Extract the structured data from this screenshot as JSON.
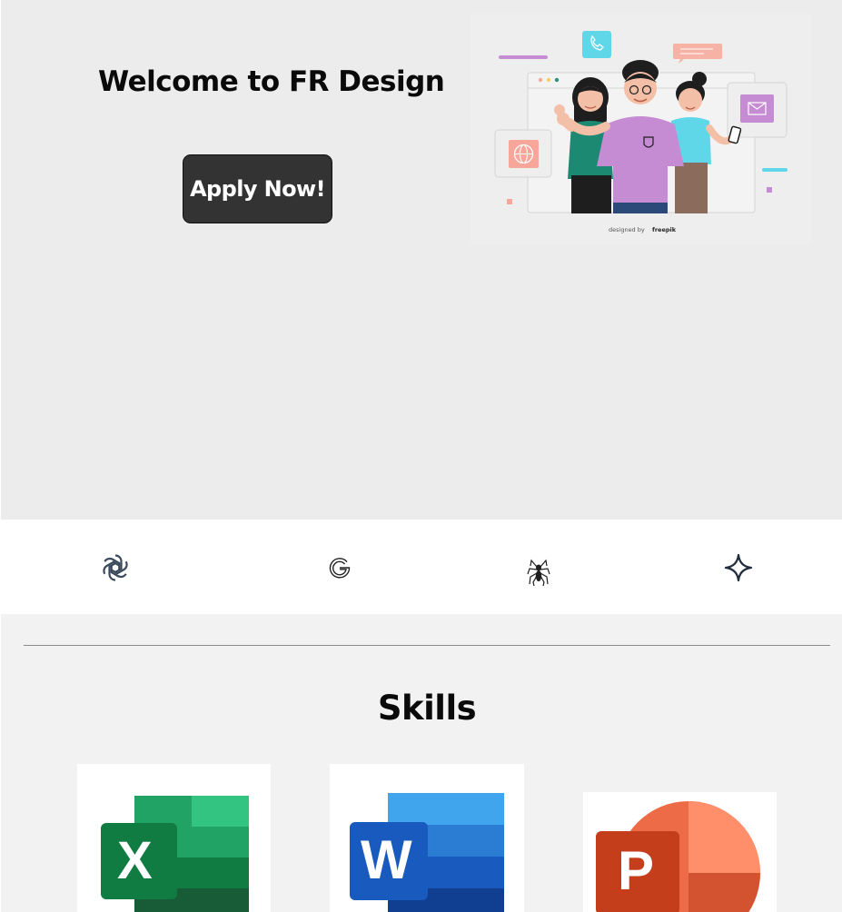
{
  "hero": {
    "title": "Welcome to FR Design",
    "apply_label": "Apply Now!",
    "illustration": {
      "credit_prefix": "designed by",
      "credit_brand": "freepik"
    }
  },
  "logos": [
    {
      "icon": "openai-icon"
    },
    {
      "icon": "google-g-icon"
    },
    {
      "icon": "spider-icon"
    },
    {
      "icon": "sparkle-star-icon"
    }
  ],
  "skills": {
    "title": "Skills",
    "items": [
      {
        "icon": "excel-icon",
        "letter": "X",
        "color": "#107c41"
      },
      {
        "icon": "word-icon",
        "letter": "W",
        "color": "#185abd"
      },
      {
        "icon": "powerpoint-icon",
        "letter": "P",
        "color": "#c43e1c"
      }
    ]
  },
  "colors": {
    "hero_bg": "#ececec",
    "button_bg": "#333333",
    "skills_bg": "#f2f2f2"
  }
}
